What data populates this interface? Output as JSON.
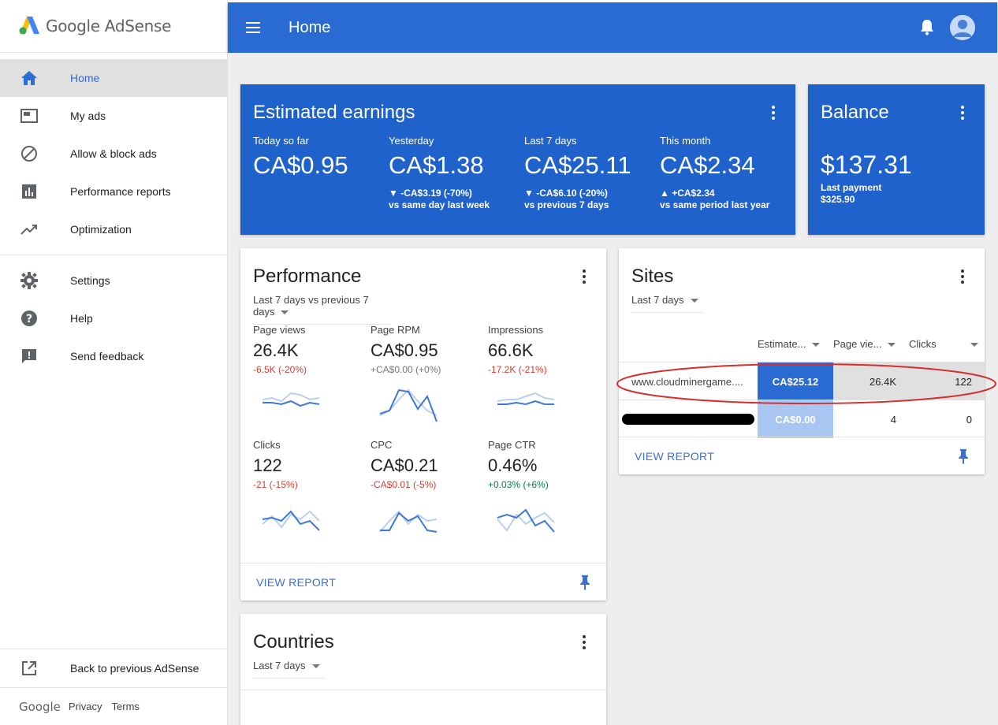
{
  "app": {
    "logo_text": "Google AdSense"
  },
  "sidebar": {
    "items": [
      {
        "label": "Home",
        "icon": "home-icon"
      },
      {
        "label": "My ads",
        "icon": "ad-unit-icon"
      },
      {
        "label": "Allow & block ads",
        "icon": "block-icon"
      },
      {
        "label": "Performance reports",
        "icon": "bar-chart-icon"
      },
      {
        "label": "Optimization",
        "icon": "trending-up-icon"
      },
      {
        "label": "Settings",
        "icon": "gear-icon"
      },
      {
        "label": "Help",
        "icon": "help-icon"
      },
      {
        "label": "Send feedback",
        "icon": "feedback-icon"
      }
    ],
    "back_label": "Back to previous AdSense",
    "footer": {
      "google": "Google",
      "privacy": "Privacy",
      "terms": "Terms"
    }
  },
  "header": {
    "title": "Home"
  },
  "earnings": {
    "title": "Estimated earnings",
    "cols": [
      {
        "label": "Today so far",
        "value": "CA$0.95",
        "change": "",
        "compare": ""
      },
      {
        "label": "Yesterday",
        "value": "CA$1.38",
        "change": "▼ -CA$3.19 (-70%)",
        "compare": "vs same day last week"
      },
      {
        "label": "Last 7 days",
        "value": "CA$25.11",
        "change": "▼ -CA$6.10 (-20%)",
        "compare": "vs previous 7 days"
      },
      {
        "label": "This month",
        "value": "CA$2.34",
        "change": "▲ +CA$2.34",
        "compare": "vs same period last year"
      }
    ]
  },
  "balance": {
    "title": "Balance",
    "value": "$137.31",
    "last_payment_label": "Last payment",
    "last_payment_value": "$325.90"
  },
  "performance": {
    "title": "Performance",
    "range": "Last 7 days vs previous 7 days",
    "metrics": [
      {
        "label": "Page views",
        "value": "26.4K",
        "change": "-6.5K (-20%)"
      },
      {
        "label": "Page RPM",
        "value": "CA$0.95",
        "change": "+CA$0.00 (+0%)"
      },
      {
        "label": "Impressions",
        "value": "66.6K",
        "change": "-17.2K (-21%)"
      },
      {
        "label": "Clicks",
        "value": "122",
        "change": "-21 (-15%)"
      },
      {
        "label": "CPC",
        "value": "CA$0.21",
        "change": "-CA$0.01 (-5%)"
      },
      {
        "label": "Page CTR",
        "value": "0.46%",
        "change": "+0.03% (+6%)"
      }
    ],
    "view_report": "VIEW REPORT"
  },
  "sites": {
    "title": "Sites",
    "range": "Last 7 days",
    "columns": [
      "Estimate...",
      "Page vie...",
      "Clicks"
    ],
    "rows": [
      {
        "site": "www.cloudminergame....",
        "earnings": "CA$25.12",
        "page_views": "26.4K",
        "clicks": "122"
      },
      {
        "site": "",
        "earnings": "CA$0.00",
        "page_views": "4",
        "clicks": "0"
      }
    ],
    "view_report": "VIEW REPORT"
  },
  "countries": {
    "title": "Countries",
    "range": "Last 7 days"
  },
  "colors": {
    "header": "#2a6ad3",
    "card_blue": "#1f62cc",
    "accent": "#3b6fd1",
    "highlight": "#d32f2f"
  }
}
